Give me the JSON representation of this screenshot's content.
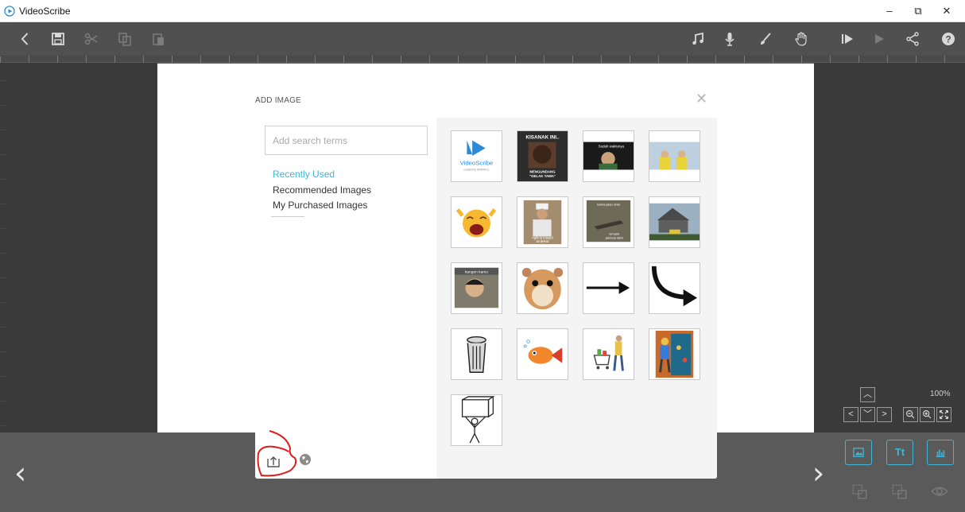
{
  "window": {
    "title": "VideoScribe",
    "minimize": "–",
    "restore": "⧉",
    "close": "✕"
  },
  "toolbar": {
    "left": [
      "back-icon",
      "save-icon",
      "cut-icon",
      "copy-icon",
      "paste-icon"
    ],
    "right": [
      "music-icon",
      "microphone-icon",
      "brush-icon",
      "hand-icon",
      "play-from-here-icon",
      "play-icon",
      "share-icon",
      "help-icon"
    ]
  },
  "zoom": {
    "level": "100%"
  },
  "bottom": {
    "image_button": "▣",
    "text_button": "Tt",
    "chart_button": "▥"
  },
  "dialog": {
    "title": "ADD IMAGE",
    "close": "✕",
    "search_placeholder": "Add search terms",
    "menu": [
      {
        "label": "Recently Used",
        "active": true
      },
      {
        "label": "Recommended Images",
        "active": false
      },
      {
        "label": "My Purchased Images",
        "active": false
      }
    ],
    "thumbnails": [
      {
        "name": "videoscribe-logo",
        "texts": [
          "VideoScribe",
          "created by SPARKOL"
        ]
      },
      {
        "name": "meme-kisanak-ini",
        "texts": [
          "KISANAK INI..",
          "MENGUNDANG",
          "\"GELAK TAWA\""
        ]
      },
      {
        "name": "meme-sudah-waktunya",
        "texts": [
          "Sudah waktunya"
        ]
      },
      {
        "name": "meme-yellow-people",
        "texts": []
      },
      {
        "name": "crying-emoji",
        "texts": []
      },
      {
        "name": "meme-chef",
        "texts": [
          "ngikuti masjid",
          "terdekat"
        ]
      },
      {
        "name": "meme-kukira-jalan-cinta",
        "texts": [
          "kukira jalan cinta",
          "ternyata",
          "jatuhnya disini"
        ]
      },
      {
        "name": "house-moving-truck",
        "texts": []
      },
      {
        "name": "selfie-boy",
        "texts": [
          "kangen kamu"
        ]
      },
      {
        "name": "hamster",
        "texts": []
      },
      {
        "name": "straight-arrow",
        "texts": []
      },
      {
        "name": "curved-arrow",
        "texts": []
      },
      {
        "name": "trash-can",
        "texts": []
      },
      {
        "name": "cartoon-fish",
        "texts": []
      },
      {
        "name": "shopping-cart-man",
        "texts": []
      },
      {
        "name": "boy-aquarium",
        "texts": []
      },
      {
        "name": "man-carrying-box",
        "texts": []
      }
    ]
  }
}
